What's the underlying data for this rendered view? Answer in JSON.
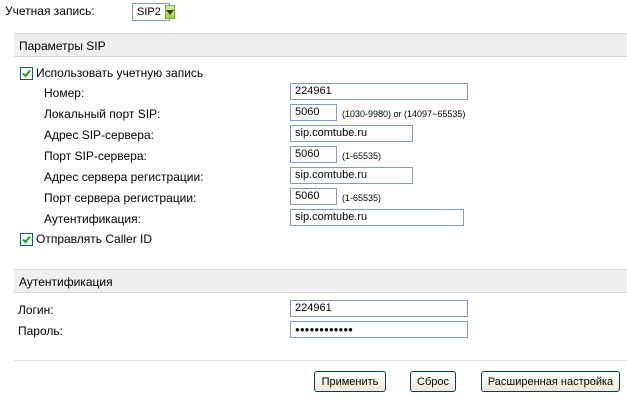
{
  "account": {
    "label": "Учетная запись:",
    "selected": "SIP2"
  },
  "sip_params": {
    "title": "Параметры SIP",
    "use_account": {
      "label": "Использовать учетную запись",
      "checked": true
    },
    "fields": [
      {
        "label": "Номер:",
        "value": "224961",
        "hint": ""
      },
      {
        "label": "Локальный порт SIP:",
        "value": "5060",
        "hint": "(1030-9980) or (14097~65535)"
      },
      {
        "label": "Адрес SIP-сервера:",
        "value": "sip.comtube.ru",
        "hint": ""
      },
      {
        "label": "Порт SIP-сервера:",
        "value": "5060",
        "hint": "(1-65535)"
      },
      {
        "label": "Адрес сервера регистрации:",
        "value": "sip.comtube.ru",
        "hint": ""
      },
      {
        "label": "Порт сервера регистрации:",
        "value": "5060",
        "hint": "(1-65535)"
      },
      {
        "label": "Аутентификация:",
        "value": "sip.comtube.ru",
        "hint": ""
      }
    ],
    "caller_id": {
      "label": "Отправлять Caller ID",
      "checked": true
    }
  },
  "auth": {
    "title": "Аутентификация",
    "login_label": "Логин:",
    "login_value": "224961",
    "password_label": "Пароль:",
    "password_value": "●●●●●●●●●●●●"
  },
  "buttons": {
    "apply": "Применить",
    "reset": "Сброс",
    "advanced": "Расширенная настройка"
  }
}
